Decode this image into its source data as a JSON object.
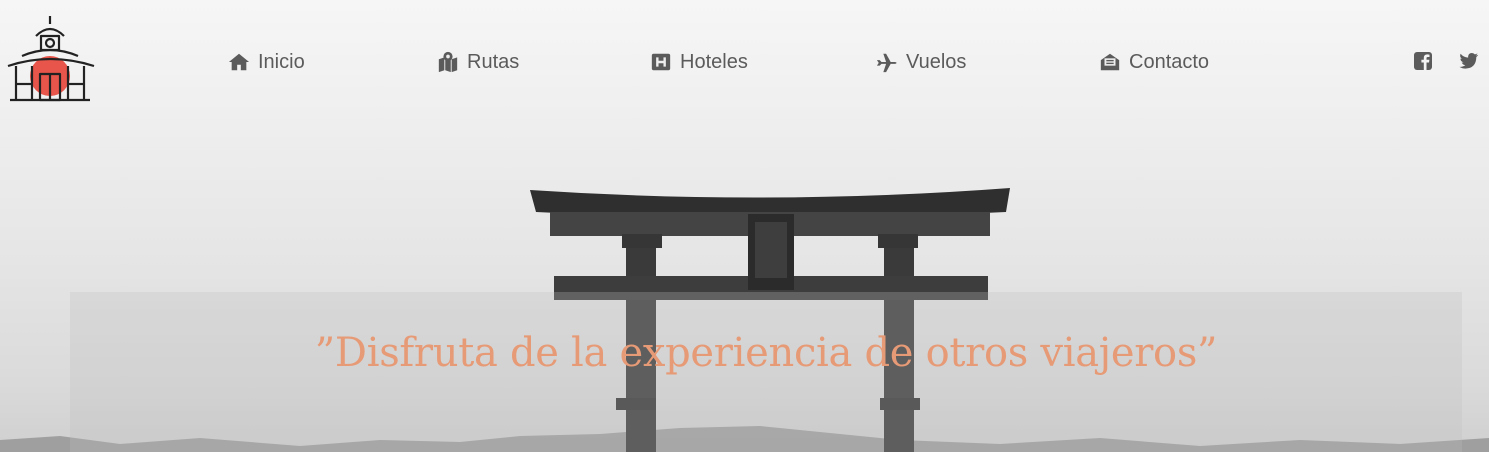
{
  "nav": {
    "items": [
      {
        "label": "Inicio",
        "icon": "home-icon"
      },
      {
        "label": "Rutas",
        "icon": "map-marker-icon"
      },
      {
        "label": "Hoteles",
        "icon": "hotel-h-icon"
      },
      {
        "label": "Vuelos",
        "icon": "plane-icon"
      },
      {
        "label": "Contacto",
        "icon": "envelope-open-icon"
      }
    ]
  },
  "social": [
    {
      "icon": "facebook-icon"
    },
    {
      "icon": "twitter-icon"
    }
  ],
  "hero": {
    "quote": "”Disfruta de la experiencia de otros viajeros”"
  },
  "colors": {
    "accent": "#e79a76",
    "logo_sun": "#e8554a",
    "nav_text": "#5b5b5b"
  }
}
